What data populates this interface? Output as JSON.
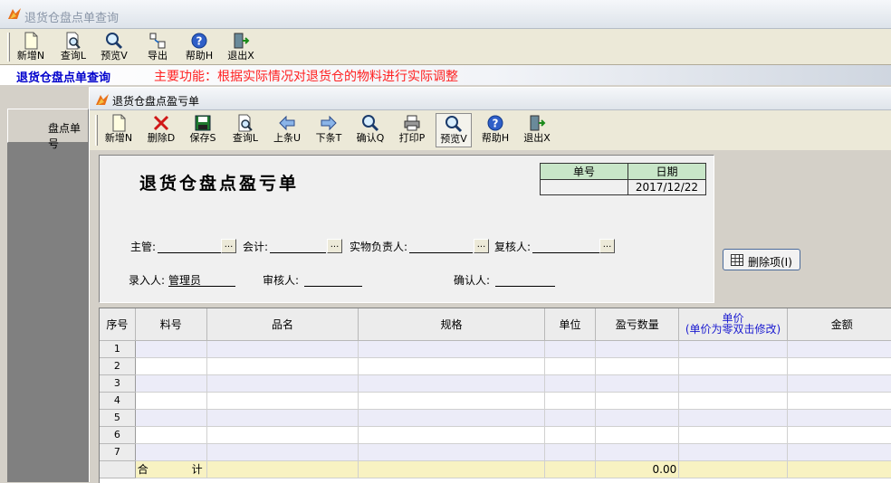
{
  "outer_window": {
    "title": "退货仓盘点单查询",
    "toolbar": [
      {
        "label": "新增N",
        "icon": "new-document-icon"
      },
      {
        "label": "查询L",
        "icon": "search-document-icon"
      },
      {
        "label": "预览V",
        "icon": "magnifier-icon"
      },
      {
        "label": "导出",
        "icon": "export-icon"
      },
      {
        "label": "帮助H",
        "icon": "help-icon"
      },
      {
        "label": "退出X",
        "icon": "exit-icon"
      }
    ],
    "module_title": "退货仓盘点单查询",
    "function_description": "主要功能：根据实际情况对退货仓的物料进行实际调整",
    "background_column_header": "盘点单号"
  },
  "inner_window": {
    "title": "退货仓盘点盈亏单",
    "toolbar": [
      {
        "label": "新增N",
        "icon": "new-document-icon"
      },
      {
        "label": "删除D",
        "icon": "delete-x-icon"
      },
      {
        "label": "保存S",
        "icon": "save-disk-icon"
      },
      {
        "label": "查询L",
        "icon": "search-document-icon"
      },
      {
        "label": "上条U",
        "icon": "arrow-left-icon"
      },
      {
        "label": "下条T",
        "icon": "arrow-right-icon"
      },
      {
        "label": "确认Q",
        "icon": "magnifier-icon"
      },
      {
        "label": "打印P",
        "icon": "printer-icon"
      },
      {
        "label": "预览V",
        "icon": "magnifier-icon"
      },
      {
        "label": "帮助H",
        "icon": "help-icon"
      },
      {
        "label": "退出X",
        "icon": "exit-icon"
      }
    ],
    "doc_title": "退货仓盘点盈亏单",
    "info": {
      "number_label": "单号",
      "number_value": "",
      "date_label": "日期",
      "date_value": "2017/12/22"
    },
    "fields": {
      "supervisor_label": "主管:",
      "supervisor_value": "",
      "accountant_label": "会计:",
      "accountant_value": "",
      "custodian_label": "实物负责人:",
      "custodian_value": "",
      "reviewer_label": "复核人:",
      "reviewer_value": "",
      "entered_by_label": "录入人:",
      "entered_by_value": "管理员",
      "auditor_label": "审核人:",
      "auditor_value": "",
      "confirmer_label": "确认人:",
      "confirmer_value": "",
      "ellipsis": "..."
    },
    "delete_item_button": "删除项(I)",
    "grid": {
      "columns": [
        {
          "label": "序号"
        },
        {
          "label": "料号"
        },
        {
          "label": "品名"
        },
        {
          "label": "规格"
        },
        {
          "label": "单位"
        },
        {
          "label": "盈亏数量"
        },
        {
          "label": "单价",
          "label2": "(单价为零双击修改)"
        },
        {
          "label": "金额"
        }
      ],
      "rows": [
        "1",
        "2",
        "3",
        "4",
        "5",
        "6",
        "7"
      ],
      "total": {
        "label_a": "合",
        "label_b": "计",
        "quantity": "0.00"
      }
    }
  }
}
